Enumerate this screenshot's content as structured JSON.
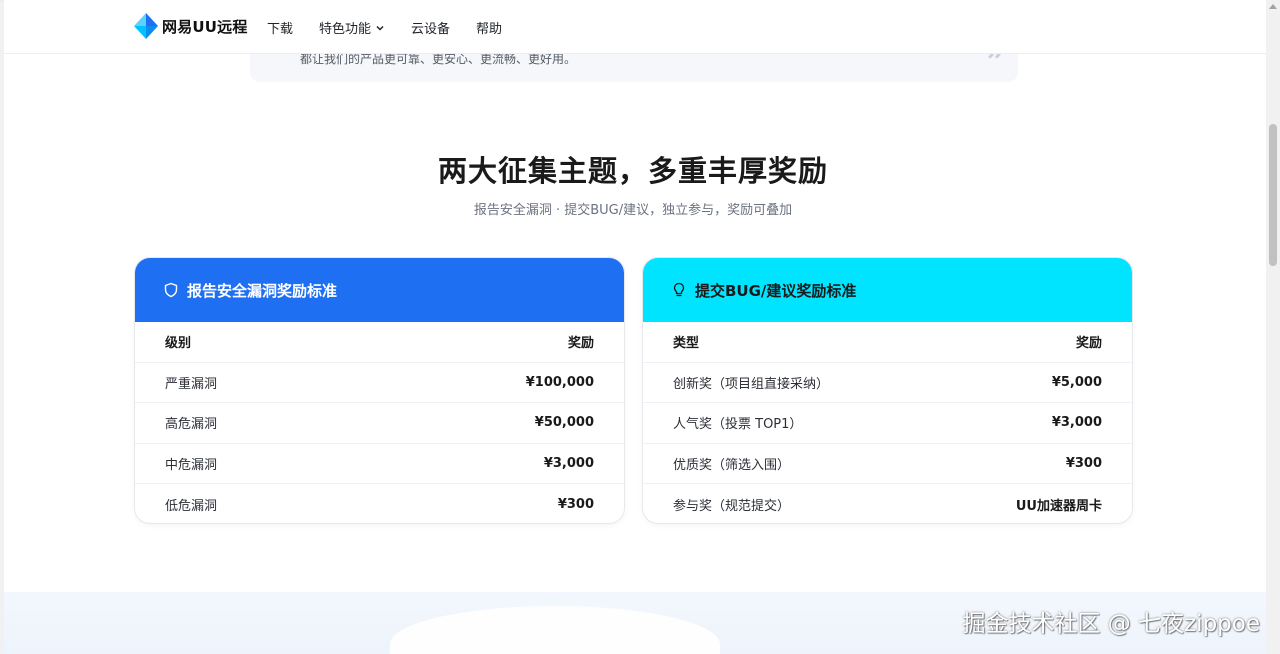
{
  "header": {
    "logo_text": "网易UU远程",
    "nav": [
      {
        "label": "下载"
      },
      {
        "label": "特色功能"
      },
      {
        "label": "云设备"
      },
      {
        "label": "帮助"
      }
    ]
  },
  "quote": {
    "text": "都让我们的产品更可靠、更安心、更流畅、更好用。",
    "mark": "”"
  },
  "section": {
    "title": "两大征集主题，多重丰厚奖励",
    "subtitle": "报告安全漏洞 · 提交BUG/建议，独立参与，奖励可叠加"
  },
  "security_card": {
    "title": "报告安全漏洞奖励标准",
    "header_color": "#1f6ff2",
    "col_level": "级别",
    "col_reward": "奖励",
    "rows": [
      {
        "level": "严重漏洞",
        "reward": "¥100,000"
      },
      {
        "level": "高危漏洞",
        "reward": "¥50,000"
      },
      {
        "level": "中危漏洞",
        "reward": "¥3,000"
      },
      {
        "level": "低危漏洞",
        "reward": "¥300"
      }
    ]
  },
  "bug_card": {
    "title": "提交BUG/建议奖励标准",
    "header_color": "#00e4ff",
    "col_type": "类型",
    "col_reward": "奖励",
    "rows": [
      {
        "type": "创新奖（项目组直接采纳）",
        "reward": "¥5,000"
      },
      {
        "type": "人气奖（投票 TOP1）",
        "reward": "¥3,000"
      },
      {
        "type": "优质奖（筛选入围）",
        "reward": "¥300"
      },
      {
        "type": "参与奖（规范提交）",
        "reward": "UU加速器周卡"
      }
    ]
  },
  "watermark": "掘金技术社区 @ 七夜zippoe"
}
